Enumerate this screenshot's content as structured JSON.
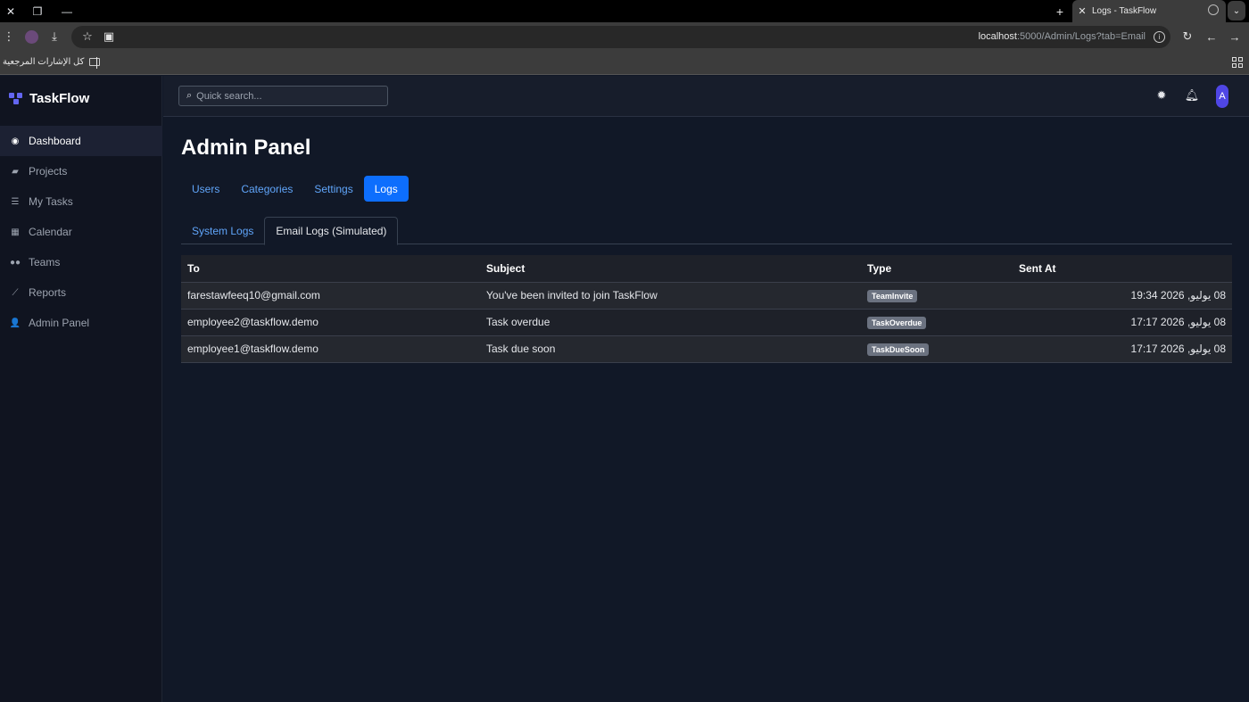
{
  "browser": {
    "tab_title": "Logs - TaskFlow",
    "url_host": "localhost",
    "url_path": ":5000/Admin/Logs?tab=Email",
    "bookmarks_label": "كل الإشارات المرجعية"
  },
  "app": {
    "brand": "TaskFlow",
    "search_placeholder": "Quick search...",
    "avatar_initial": "A"
  },
  "sidebar": {
    "items": [
      {
        "label": "Dashboard",
        "icon": "gauge-icon",
        "active": true
      },
      {
        "label": "Projects",
        "icon": "folder-icon"
      },
      {
        "label": "My Tasks",
        "icon": "list-icon"
      },
      {
        "label": "Calendar",
        "icon": "calendar-icon"
      },
      {
        "label": "Teams",
        "icon": "users-icon"
      },
      {
        "label": "Reports",
        "icon": "chart-icon"
      },
      {
        "label": "Admin Panel",
        "icon": "user-gear-icon"
      }
    ]
  },
  "main": {
    "title": "Admin Panel",
    "tabs": [
      "Users",
      "Categories",
      "Settings",
      "Logs"
    ],
    "active_tab": "Logs",
    "subtabs": [
      "System Logs",
      "Email Logs (Simulated)"
    ],
    "active_subtab": "Email Logs (Simulated)"
  },
  "table": {
    "headers": [
      "To",
      "Subject",
      "Type",
      "Sent At"
    ],
    "rows": [
      {
        "to": "farestawfeeq10@gmail.com",
        "subject": "You've been invited to join TaskFlow",
        "type": "TeamInvite",
        "sent_at": "08 يوليو, 2026 19:34"
      },
      {
        "to": "employee2@taskflow.demo",
        "subject": "Task overdue",
        "type": "TaskOverdue",
        "sent_at": "08 يوليو, 2026 17:17"
      },
      {
        "to": "employee1@taskflow.demo",
        "subject": "Task due soon",
        "type": "TaskDueSoon",
        "sent_at": "08 يوليو, 2026 17:17"
      }
    ]
  },
  "colors": {
    "accent": "#0d6efd",
    "brand": "#6366f1",
    "background": "#111827"
  }
}
